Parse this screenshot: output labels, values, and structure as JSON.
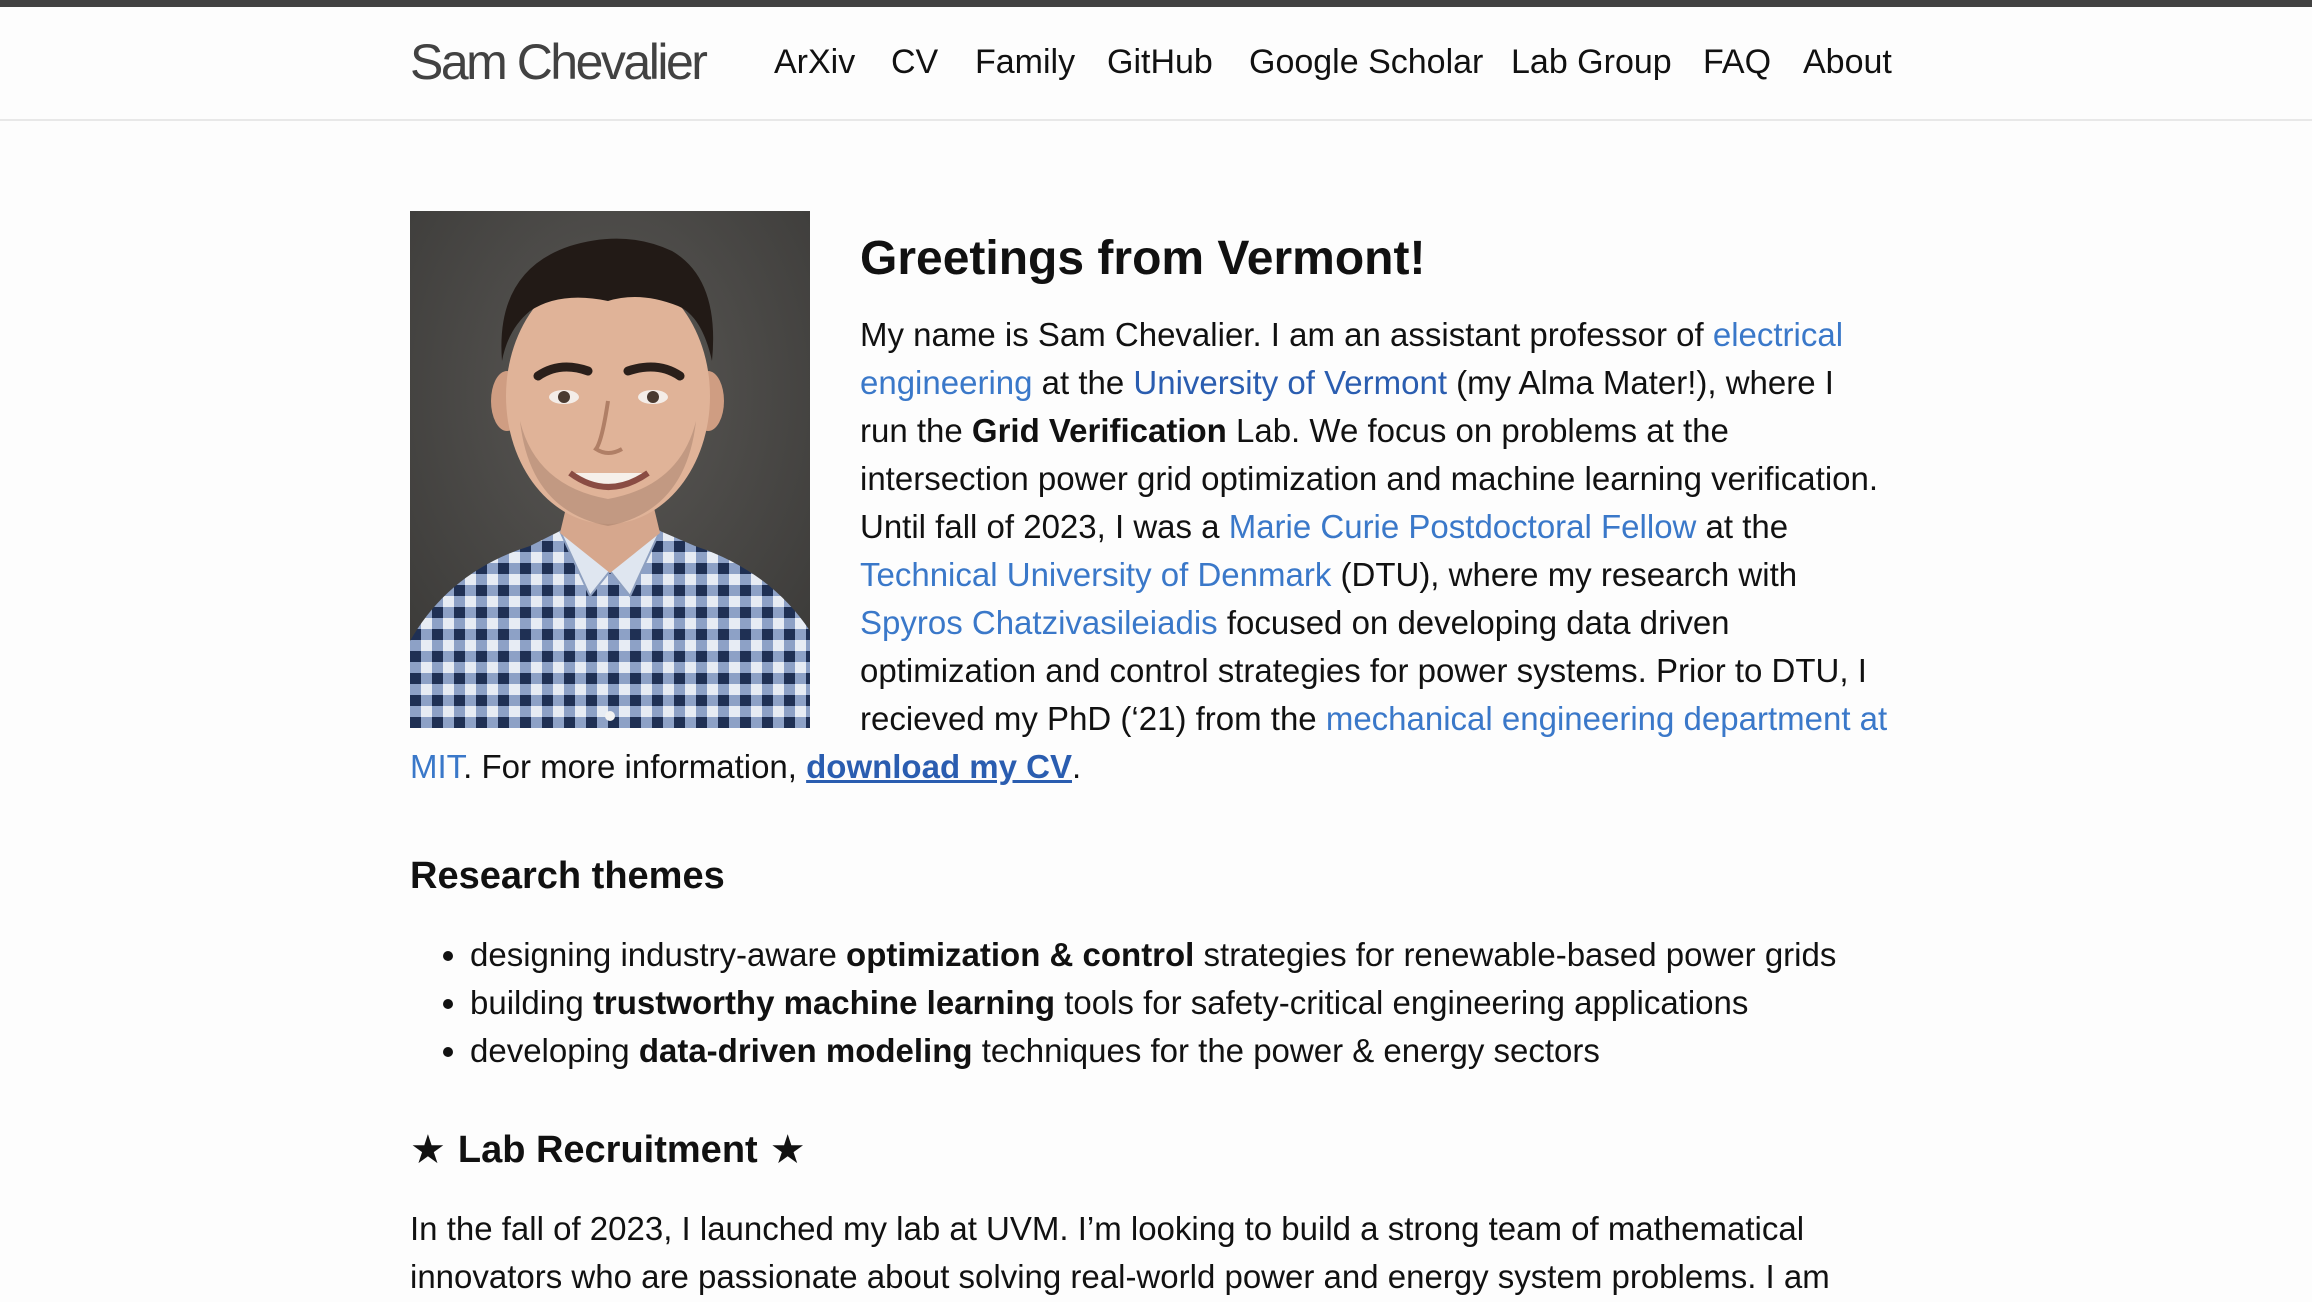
{
  "site": {
    "title": "Sam Chevalier"
  },
  "nav": [
    "ArXiv",
    "CV",
    "Family",
    "GitHub",
    "Google Scholar",
    "Lab Group",
    "FAQ",
    "About"
  ],
  "greeting": "Greetings from Vermont!",
  "bio": {
    "t1": "My name is Sam Chevalier. I am an assistant professor of ",
    "l1": "electrical engineering",
    "t2": " at the ",
    "l2": "University of Vermont",
    "t3": " (my Alma Mater!), where I run the ",
    "b1": "Grid Verification",
    "t4": " Lab. We focus on problems at the intersection power grid optimization and machine learning verification. Until fall of 2023, I was a ",
    "l3": "Marie Curie Postdoctoral Fellow",
    "t5": " at the ",
    "l4": "Technical University of Denmark",
    "t6": " (DTU), where my research with ",
    "l5": "Spyros Chatzivasileiadis",
    "t7": " focused on developing data driven optimization and control strategies for power systems. Prior to DTU, I recieved my PhD (‘21) from the ",
    "l6": "mechanical engineering department at MIT",
    "t8": ". For more information, ",
    "l7": "download my CV",
    "t9": "."
  },
  "research": {
    "heading": "Research themes",
    "items": [
      {
        "pre": "designing industry-aware ",
        "bold": "optimization & control",
        "post": " strategies for renewable-based power grids"
      },
      {
        "pre": "building ",
        "bold": "trustworthy machine learning",
        "post": " tools for safety-critical engineering applications"
      },
      {
        "pre": "developing ",
        "bold": "data-driven modeling",
        "post": " techniques for the power & energy sectors"
      }
    ]
  },
  "recruitment": {
    "star": "★",
    "heading": "Lab Recruitment",
    "text": "In the fall of 2023, I launched my lab at UVM. I’m looking to build a strong team of mathematical innovators who are passionate about solving real-world power and energy system problems. I am"
  }
}
